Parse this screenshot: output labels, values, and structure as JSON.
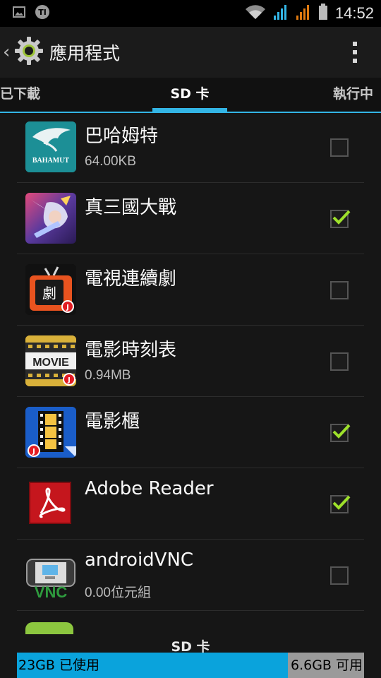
{
  "status_bar": {
    "time": "14:52",
    "icons": [
      "image-icon",
      "notification-app-icon",
      "wifi-icon",
      "signal-blue-icon",
      "signal-orange-icon",
      "battery-icon"
    ]
  },
  "action_bar": {
    "back_glyph": "‹",
    "title": "應用程式",
    "icon": "gear-icon"
  },
  "tabs": {
    "left": "已下載",
    "active": "SD 卡",
    "right": "執行中"
  },
  "apps": [
    {
      "name": "巴哈姆特",
      "size": "64.00KB",
      "checked": false,
      "icon": "bahamut-icon",
      "icon_text": "BAHAMUT"
    },
    {
      "name": "真三國大戰",
      "size": "",
      "checked": true,
      "icon": "warrior-game-icon"
    },
    {
      "name": "電視連續劇",
      "size": "",
      "checked": false,
      "icon": "tv-drama-icon",
      "icon_text": "劇"
    },
    {
      "name": "電影時刻表",
      "size": "0.94MB",
      "checked": false,
      "icon": "movie-times-icon",
      "icon_text": "MOVIE"
    },
    {
      "name": "電影櫃",
      "size": "",
      "checked": true,
      "icon": "film-cabinet-icon"
    },
    {
      "name": "Adobe Reader",
      "size": "",
      "checked": true,
      "icon": "adobe-reader-icon"
    },
    {
      "name": "androidVNC",
      "size": "0.00位元組",
      "checked": false,
      "icon": "vnc-icon",
      "icon_text": "VNC"
    }
  ],
  "footer": {
    "label": "SD 卡",
    "used_text": "23GB 已使用",
    "free_text": "6.6GB 可用",
    "used_fraction": 0.78
  },
  "colors": {
    "accent": "#33b5e5",
    "storage_used": "#0aa3dc",
    "storage_free": "#9a9a9a",
    "check_mark": "#9ee12b"
  }
}
